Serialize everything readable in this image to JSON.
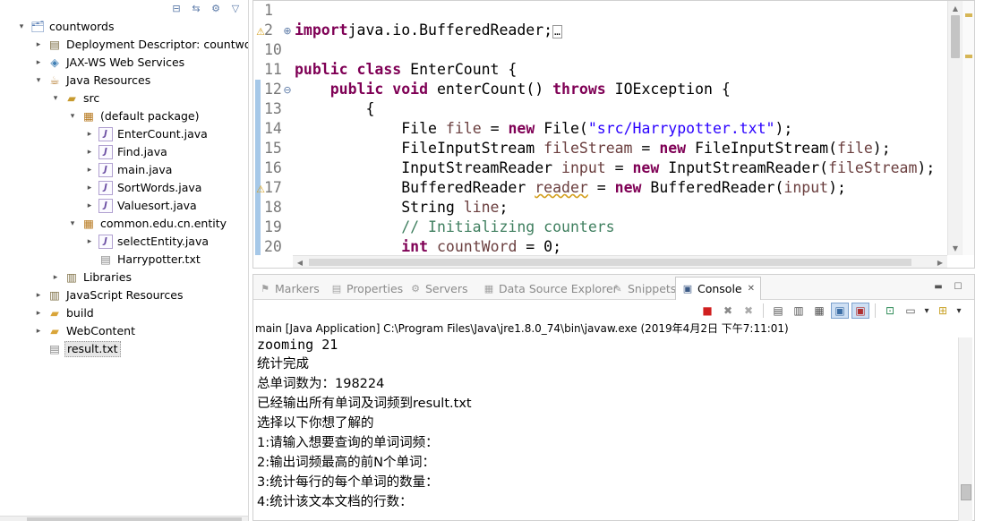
{
  "explorer": {
    "toolbar": [
      {
        "icon": "collapse-all-icon",
        "glyph": "⊟"
      },
      {
        "icon": "link-with-editor-icon",
        "glyph": "⇆"
      },
      {
        "icon": "filter-icon",
        "glyph": "⚙"
      },
      {
        "icon": "view-menu-icon",
        "glyph": "▽"
      }
    ],
    "tree": [
      {
        "label": "countwords",
        "depth": 0,
        "arrow": "▾",
        "icon": "web-project-icon",
        "glyph": "🗂",
        "color": "#5a7fb5"
      },
      {
        "label": "Deployment Descriptor: countwords",
        "depth": 1,
        "arrow": "▸",
        "icon": "deployment-descriptor-icon",
        "glyph": "▤",
        "color": "#7a6b3f"
      },
      {
        "label": "JAX-WS Web Services",
        "depth": 1,
        "arrow": "▸",
        "icon": "web-services-icon",
        "glyph": "◈",
        "color": "#3f7fb5"
      },
      {
        "label": "Java Resources",
        "depth": 1,
        "arrow": "▾",
        "icon": "java-resources-icon",
        "glyph": "☕",
        "color": "#b57b2f"
      },
      {
        "label": "src",
        "depth": 2,
        "arrow": "▾",
        "icon": "source-folder-icon",
        "glyph": "▰",
        "color": "#c79a2e"
      },
      {
        "label": "(default package)",
        "depth": 3,
        "arrow": "▾",
        "icon": "package-icon",
        "glyph": "▦",
        "color": "#b7791f"
      },
      {
        "label": "EnterCount.java",
        "depth": 4,
        "arrow": "▸",
        "icon": "java-file-icon",
        "glyph": "J",
        "color": "#6b4ea3"
      },
      {
        "label": "Find.java",
        "depth": 4,
        "arrow": "▸",
        "icon": "java-file-icon",
        "glyph": "J",
        "color": "#6b4ea3"
      },
      {
        "label": "main.java",
        "depth": 4,
        "arrow": "▸",
        "icon": "java-file-icon",
        "glyph": "J",
        "color": "#6b4ea3"
      },
      {
        "label": "SortWords.java",
        "depth": 4,
        "arrow": "▸",
        "icon": "java-file-icon",
        "glyph": "J",
        "color": "#6b4ea3"
      },
      {
        "label": "Valuesort.java",
        "depth": 4,
        "arrow": "▸",
        "icon": "java-file-icon",
        "glyph": "J",
        "color": "#6b4ea3"
      },
      {
        "label": "common.edu.cn.entity",
        "depth": 3,
        "arrow": "▾",
        "icon": "package-icon",
        "glyph": "▦",
        "color": "#b7791f"
      },
      {
        "label": "selectEntity.java",
        "depth": 4,
        "arrow": "▸",
        "icon": "java-file-icon",
        "glyph": "J",
        "color": "#6b4ea3"
      },
      {
        "label": "Harrypotter.txt",
        "depth": 4,
        "arrow": "",
        "icon": "text-file-icon",
        "glyph": "▤",
        "color": "#8a8a8a"
      },
      {
        "label": "Libraries",
        "depth": 2,
        "arrow": "▸",
        "icon": "libraries-icon",
        "glyph": "▥",
        "color": "#7a6b3f"
      },
      {
        "label": "JavaScript Resources",
        "depth": 1,
        "arrow": "▸",
        "icon": "javascript-resources-icon",
        "glyph": "▥",
        "color": "#7a6b3f"
      },
      {
        "label": "build",
        "depth": 1,
        "arrow": "▸",
        "icon": "folder-icon",
        "glyph": "▰",
        "color": "#d9a53a"
      },
      {
        "label": "WebContent",
        "depth": 1,
        "arrow": "▸",
        "icon": "folder-icon",
        "glyph": "▰",
        "color": "#d9a53a"
      },
      {
        "label": "result.txt",
        "depth": 1,
        "arrow": "",
        "icon": "text-file-icon",
        "glyph": "▤",
        "color": "#8a8a8a",
        "selected": true
      }
    ]
  },
  "editor": {
    "lines": [
      {
        "num": "1",
        "html": ""
      },
      {
        "num": "2",
        "fold": "⊕",
        "marker": "warning",
        "segments": [
          [
            "kw",
            "import"
          ],
          [
            "",
            "java.io.BufferedReader;"
          ],
          [
            "box",
            "…"
          ]
        ]
      },
      {
        "num": "10",
        "segments": []
      },
      {
        "num": "11",
        "segments": [
          [
            "kw",
            "public"
          ],
          [
            "",
            " "
          ],
          [
            "kw",
            "class"
          ],
          [
            "",
            " EnterCount {"
          ]
        ]
      },
      {
        "num": "12",
        "fold": "⊖",
        "segments": [
          [
            "",
            "    "
          ],
          [
            "kw",
            "public"
          ],
          [
            "",
            " "
          ],
          [
            "kw",
            "void"
          ],
          [
            "",
            " enterCount() "
          ],
          [
            "kw",
            "throws"
          ],
          [
            "",
            " IOException {"
          ]
        ]
      },
      {
        "num": "13",
        "segments": [
          [
            "",
            "        {"
          ]
        ]
      },
      {
        "num": "14",
        "segments": [
          [
            "",
            "            File "
          ],
          [
            "var",
            "file"
          ],
          [
            "",
            " = "
          ],
          [
            "kw",
            "new"
          ],
          [
            "",
            " File("
          ],
          [
            "str",
            "\"src/Harrypotter.txt\""
          ],
          [
            "",
            ");"
          ]
        ]
      },
      {
        "num": "15",
        "segments": [
          [
            "",
            "            FileInputStream "
          ],
          [
            "var",
            "fileStream"
          ],
          [
            "",
            " = "
          ],
          [
            "kw",
            "new"
          ],
          [
            "",
            " FileInputStream("
          ],
          [
            "var",
            "file"
          ],
          [
            "",
            ");"
          ]
        ]
      },
      {
        "num": "16",
        "segments": [
          [
            "",
            "            InputStreamReader "
          ],
          [
            "var",
            "input"
          ],
          [
            "",
            " = "
          ],
          [
            "kw",
            "new"
          ],
          [
            "",
            " InputStreamReader("
          ],
          [
            "var",
            "fileStream"
          ],
          [
            "",
            ");"
          ]
        ]
      },
      {
        "num": "17",
        "marker": "warning",
        "segments": [
          [
            "",
            "            BufferedReader "
          ],
          [
            "warnvar",
            "reader"
          ],
          [
            "",
            " = "
          ],
          [
            "kw",
            "new"
          ],
          [
            "",
            " BufferedReader("
          ],
          [
            "var",
            "input"
          ],
          [
            "",
            ");"
          ]
        ]
      },
      {
        "num": "18",
        "segments": [
          [
            "",
            "            String "
          ],
          [
            "var",
            "line"
          ],
          [
            "",
            ";"
          ]
        ]
      },
      {
        "num": "19",
        "segments": [
          [
            "cmt",
            "            // Initializing counters"
          ]
        ]
      },
      {
        "num": "20",
        "segments": [
          [
            "",
            "            "
          ],
          [
            "kw",
            "int"
          ],
          [
            "",
            " "
          ],
          [
            "var",
            "countWord"
          ],
          [
            "",
            " = 0;"
          ]
        ]
      }
    ]
  },
  "console": {
    "tabs": [
      {
        "label": "Markers",
        "icon": "markers-icon",
        "glyph": "⚑"
      },
      {
        "label": "Properties",
        "icon": "properties-icon",
        "glyph": "▤"
      },
      {
        "label": "Servers",
        "icon": "servers-icon",
        "glyph": "⚙"
      },
      {
        "label": "Data Source Explorer",
        "icon": "data-source-icon",
        "glyph": "▦"
      },
      {
        "label": "Snippets",
        "icon": "snippets-icon",
        "glyph": "✎"
      },
      {
        "label": "Console",
        "icon": "console-icon",
        "glyph": "▣",
        "active": true,
        "close": "✕"
      }
    ],
    "launch": "main [Java Application] C:\\Program Files\\Java\\jre1.8.0_74\\bin\\javaw.exe (2019年4月2日 下午7:11:01)",
    "output": [
      {
        "text": "zooming 21",
        "cjk": false
      },
      {
        "text": "统计完成",
        "cjk": true
      },
      {
        "text": "总单词数为：198224",
        "cjk": true
      },
      {
        "text": "已经输出所有单词及词频到result.txt",
        "cjk": true
      },
      {
        "text": "选择以下你想了解的",
        "cjk": true
      },
      {
        "text": "1:请输入想要查询的单词词频：",
        "cjk": true
      },
      {
        "text": "2:输出词频最高的前N个单词：",
        "cjk": true
      },
      {
        "text": "3:统计每行的每个单词的数量：",
        "cjk": true
      },
      {
        "text": "4:统计该文本文档的行数：",
        "cjk": true
      }
    ],
    "toolbar": [
      {
        "icon": "terminate-icon",
        "glyph": "■",
        "color": "#d02020"
      },
      {
        "icon": "remove-launch-icon",
        "glyph": "✖",
        "color": "#888"
      },
      {
        "icon": "remove-all-terminated-icon",
        "glyph": "✖",
        "color": "#aaa"
      },
      {
        "sep": true
      },
      {
        "icon": "clear-console-icon",
        "glyph": "▤",
        "color": "#555"
      },
      {
        "icon": "scroll-lock-icon",
        "glyph": "▥",
        "color": "#555"
      },
      {
        "icon": "word-wrap-icon",
        "glyph": "▦",
        "color": "#555"
      },
      {
        "icon": "show-on-stdout-icon",
        "glyph": "▣",
        "color": "#3c6ea5",
        "pressed": true
      },
      {
        "icon": "show-on-stderr-icon",
        "glyph": "▣",
        "color": "#b03030",
        "pressed": true
      },
      {
        "sep": true
      },
      {
        "icon": "pin-console-icon",
        "glyph": "⊡",
        "color": "#2e8b57"
      },
      {
        "icon": "display-selected-console-icon",
        "glyph": "▭",
        "color": "#555"
      },
      {
        "icon": "dropdown-arrow-icon",
        "glyph": "▾",
        "color": "#333"
      },
      {
        "icon": "open-console-icon",
        "glyph": "⊞",
        "color": "#c9a227"
      },
      {
        "icon": "dropdown-arrow-icon",
        "glyph": "▾",
        "color": "#333"
      }
    ],
    "window_buttons": [
      {
        "icon": "minimize-icon",
        "glyph": "▬"
      },
      {
        "icon": "maximize-icon",
        "glyph": "☐"
      }
    ]
  }
}
